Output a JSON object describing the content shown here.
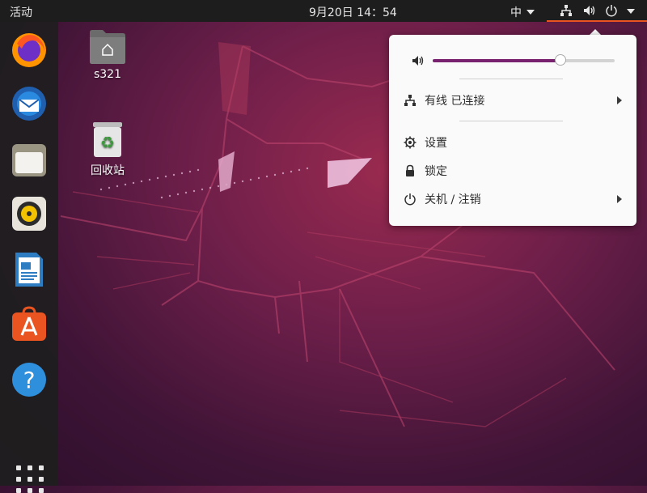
{
  "topbar": {
    "activities": "活动",
    "clock": "9月20日  14：54",
    "input_method": "中"
  },
  "dock": {
    "items": [
      {
        "name": "firefox-icon"
      },
      {
        "name": "thunderbird-icon"
      },
      {
        "name": "files-icon"
      },
      {
        "name": "rhythmbox-icon"
      },
      {
        "name": "libreoffice-writer-icon"
      },
      {
        "name": "ubuntu-software-icon"
      },
      {
        "name": "help-icon"
      }
    ]
  },
  "desktop": {
    "home_folder": "s321",
    "trash": "回收站"
  },
  "menu": {
    "volume_level": 0.7,
    "wired": "有线 已连接",
    "settings": "设置",
    "lock": "锁定",
    "power": "关机 / 注销"
  },
  "colors": {
    "accent": "#e95420",
    "slider": "#77216f"
  }
}
